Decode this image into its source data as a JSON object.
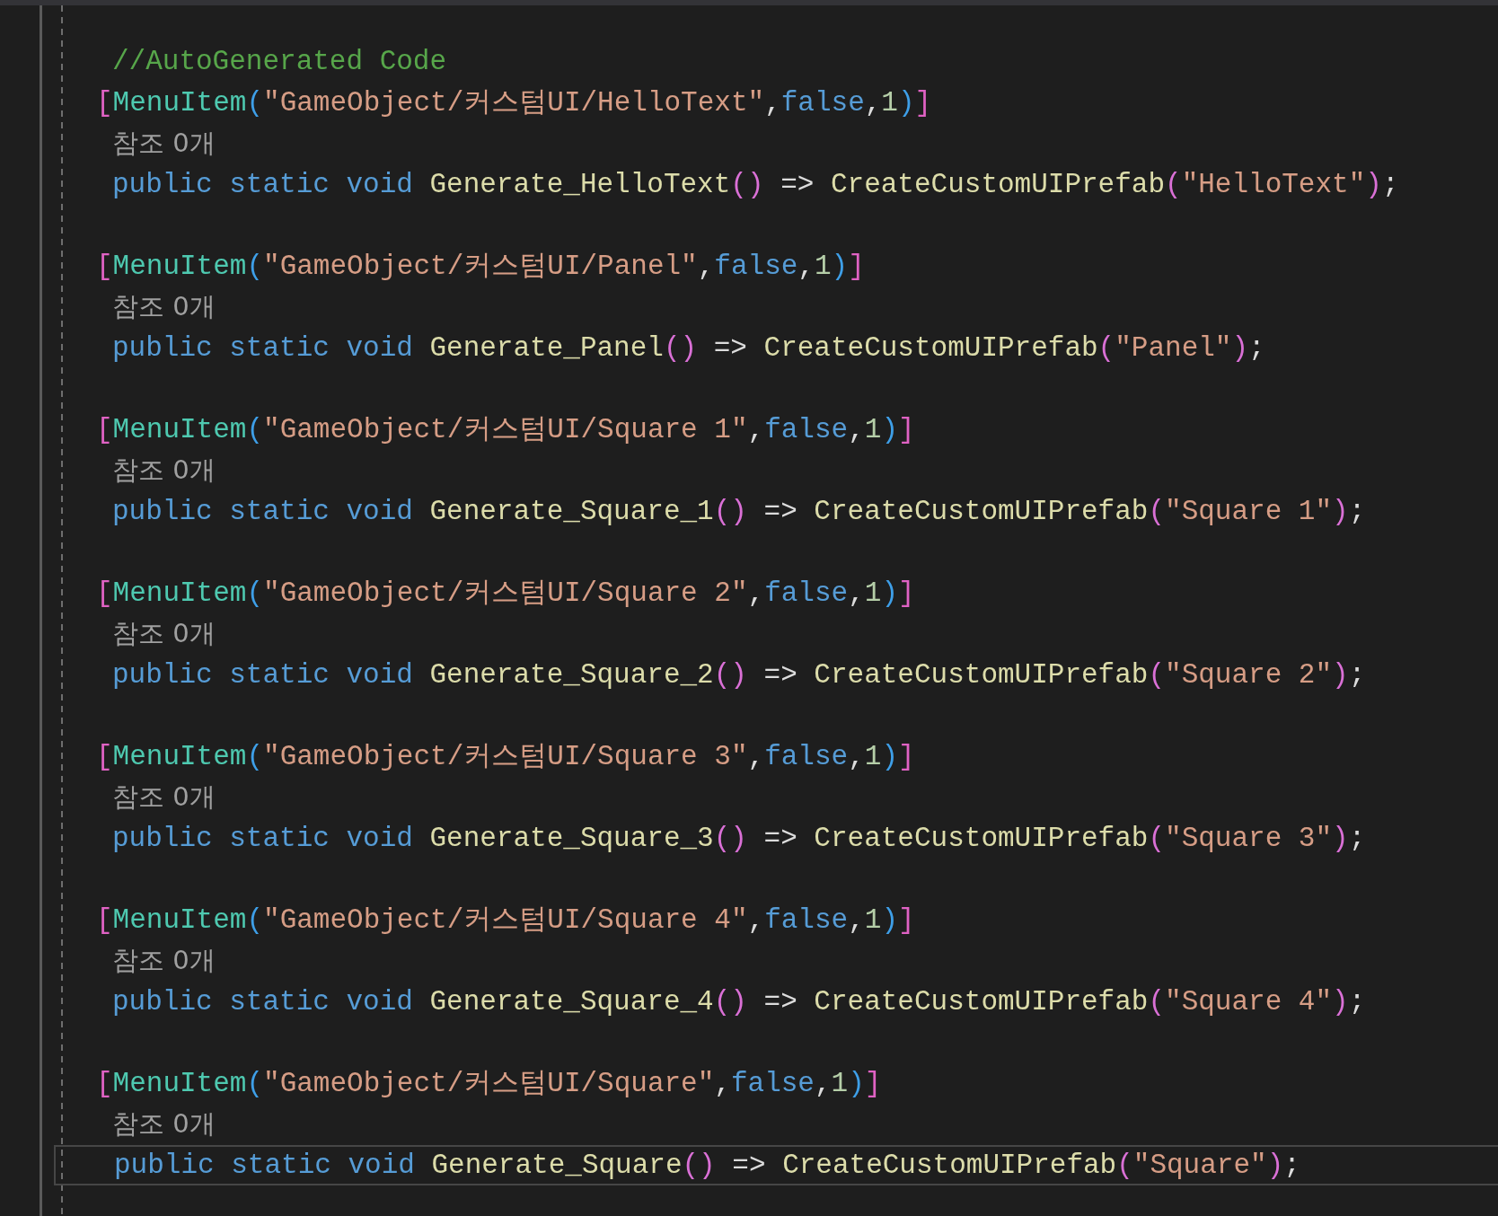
{
  "editor": {
    "lines": [
      {
        "kind": "comment",
        "text": "//AutoGenerated Code"
      },
      {
        "kind": "attribute",
        "tokens": [
          {
            "kind": "bracket",
            "text": "["
          },
          {
            "kind": "type",
            "text": "MenuItem"
          },
          {
            "kind": "paren1",
            "text": "("
          },
          {
            "kind": "string",
            "text": "\"GameObject/커스텀UI/HelloText\""
          },
          {
            "kind": "punct",
            "text": ","
          },
          {
            "kind": "keyword",
            "text": "false"
          },
          {
            "kind": "punct",
            "text": ","
          },
          {
            "kind": "number",
            "text": "1"
          },
          {
            "kind": "paren1",
            "text": ")"
          },
          {
            "kind": "bracket",
            "text": "]"
          }
        ]
      },
      {
        "kind": "codelens",
        "text": "참조 0개"
      },
      {
        "kind": "code",
        "current": false,
        "tokens": [
          {
            "kind": "decl",
            "text": "public static void"
          },
          {
            "kind": "method",
            "text": "Generate_HelloText"
          },
          {
            "kind": "paren2",
            "text": "()"
          },
          {
            "kind": "punct",
            "text": " => "
          },
          {
            "kind": "method",
            "text": "CreateCustomUIPrefab"
          },
          {
            "kind": "paren2",
            "text": "("
          },
          {
            "kind": "string",
            "text": "\"HelloText\""
          },
          {
            "kind": "paren2",
            "text": ")"
          },
          {
            "kind": "punct",
            "text": ";"
          }
        ]
      },
      {
        "kind": "blank"
      },
      {
        "kind": "attribute",
        "tokens": [
          {
            "kind": "bracket",
            "text": "["
          },
          {
            "kind": "type",
            "text": "MenuItem"
          },
          {
            "kind": "paren1",
            "text": "("
          },
          {
            "kind": "string",
            "text": "\"GameObject/커스텀UI/Panel\""
          },
          {
            "kind": "punct",
            "text": ","
          },
          {
            "kind": "keyword",
            "text": "false"
          },
          {
            "kind": "punct",
            "text": ","
          },
          {
            "kind": "number",
            "text": "1"
          },
          {
            "kind": "paren1",
            "text": ")"
          },
          {
            "kind": "bracket",
            "text": "]"
          }
        ]
      },
      {
        "kind": "codelens",
        "text": "참조 0개"
      },
      {
        "kind": "code",
        "current": false,
        "tokens": [
          {
            "kind": "decl",
            "text": "public static void"
          },
          {
            "kind": "method",
            "text": "Generate_Panel"
          },
          {
            "kind": "paren2",
            "text": "()"
          },
          {
            "kind": "punct",
            "text": " => "
          },
          {
            "kind": "method",
            "text": "CreateCustomUIPrefab"
          },
          {
            "kind": "paren2",
            "text": "("
          },
          {
            "kind": "string",
            "text": "\"Panel\""
          },
          {
            "kind": "paren2",
            "text": ")"
          },
          {
            "kind": "punct",
            "text": ";"
          }
        ]
      },
      {
        "kind": "blank"
      },
      {
        "kind": "attribute",
        "tokens": [
          {
            "kind": "bracket",
            "text": "["
          },
          {
            "kind": "type",
            "text": "MenuItem"
          },
          {
            "kind": "paren1",
            "text": "("
          },
          {
            "kind": "string",
            "text": "\"GameObject/커스텀UI/Square 1\""
          },
          {
            "kind": "punct",
            "text": ","
          },
          {
            "kind": "keyword",
            "text": "false"
          },
          {
            "kind": "punct",
            "text": ","
          },
          {
            "kind": "number",
            "text": "1"
          },
          {
            "kind": "paren1",
            "text": ")"
          },
          {
            "kind": "bracket",
            "text": "]"
          }
        ]
      },
      {
        "kind": "codelens",
        "text": "참조 0개"
      },
      {
        "kind": "code",
        "current": false,
        "tokens": [
          {
            "kind": "decl",
            "text": "public static void"
          },
          {
            "kind": "method",
            "text": "Generate_Square_1"
          },
          {
            "kind": "paren2",
            "text": "()"
          },
          {
            "kind": "punct",
            "text": " => "
          },
          {
            "kind": "method",
            "text": "CreateCustomUIPrefab"
          },
          {
            "kind": "paren2",
            "text": "("
          },
          {
            "kind": "string",
            "text": "\"Square 1\""
          },
          {
            "kind": "paren2",
            "text": ")"
          },
          {
            "kind": "punct",
            "text": ";"
          }
        ]
      },
      {
        "kind": "blank"
      },
      {
        "kind": "attribute",
        "tokens": [
          {
            "kind": "bracket",
            "text": "["
          },
          {
            "kind": "type",
            "text": "MenuItem"
          },
          {
            "kind": "paren1",
            "text": "("
          },
          {
            "kind": "string",
            "text": "\"GameObject/커스텀UI/Square 2\""
          },
          {
            "kind": "punct",
            "text": ","
          },
          {
            "kind": "keyword",
            "text": "false"
          },
          {
            "kind": "punct",
            "text": ","
          },
          {
            "kind": "number",
            "text": "1"
          },
          {
            "kind": "paren1",
            "text": ")"
          },
          {
            "kind": "bracket",
            "text": "]"
          }
        ]
      },
      {
        "kind": "codelens",
        "text": "참조 0개"
      },
      {
        "kind": "code",
        "current": false,
        "tokens": [
          {
            "kind": "decl",
            "text": "public static void"
          },
          {
            "kind": "method",
            "text": "Generate_Square_2"
          },
          {
            "kind": "paren2",
            "text": "()"
          },
          {
            "kind": "punct",
            "text": " => "
          },
          {
            "kind": "method",
            "text": "CreateCustomUIPrefab"
          },
          {
            "kind": "paren2",
            "text": "("
          },
          {
            "kind": "string",
            "text": "\"Square 2\""
          },
          {
            "kind": "paren2",
            "text": ")"
          },
          {
            "kind": "punct",
            "text": ";"
          }
        ]
      },
      {
        "kind": "blank"
      },
      {
        "kind": "attribute",
        "tokens": [
          {
            "kind": "bracket",
            "text": "["
          },
          {
            "kind": "type",
            "text": "MenuItem"
          },
          {
            "kind": "paren1",
            "text": "("
          },
          {
            "kind": "string",
            "text": "\"GameObject/커스텀UI/Square 3\""
          },
          {
            "kind": "punct",
            "text": ","
          },
          {
            "kind": "keyword",
            "text": "false"
          },
          {
            "kind": "punct",
            "text": ","
          },
          {
            "kind": "number",
            "text": "1"
          },
          {
            "kind": "paren1",
            "text": ")"
          },
          {
            "kind": "bracket",
            "text": "]"
          }
        ]
      },
      {
        "kind": "codelens",
        "text": "참조 0개"
      },
      {
        "kind": "code",
        "current": false,
        "tokens": [
          {
            "kind": "decl",
            "text": "public static void"
          },
          {
            "kind": "method",
            "text": "Generate_Square_3"
          },
          {
            "kind": "paren2",
            "text": "()"
          },
          {
            "kind": "punct",
            "text": " => "
          },
          {
            "kind": "method",
            "text": "CreateCustomUIPrefab"
          },
          {
            "kind": "paren2",
            "text": "("
          },
          {
            "kind": "string",
            "text": "\"Square 3\""
          },
          {
            "kind": "paren2",
            "text": ")"
          },
          {
            "kind": "punct",
            "text": ";"
          }
        ]
      },
      {
        "kind": "blank"
      },
      {
        "kind": "attribute",
        "tokens": [
          {
            "kind": "bracket",
            "text": "["
          },
          {
            "kind": "type",
            "text": "MenuItem"
          },
          {
            "kind": "paren1",
            "text": "("
          },
          {
            "kind": "string",
            "text": "\"GameObject/커스텀UI/Square 4\""
          },
          {
            "kind": "punct",
            "text": ","
          },
          {
            "kind": "keyword",
            "text": "false"
          },
          {
            "kind": "punct",
            "text": ","
          },
          {
            "kind": "number",
            "text": "1"
          },
          {
            "kind": "paren1",
            "text": ")"
          },
          {
            "kind": "bracket",
            "text": "]"
          }
        ]
      },
      {
        "kind": "codelens",
        "text": "참조 0개"
      },
      {
        "kind": "code",
        "current": false,
        "tokens": [
          {
            "kind": "decl",
            "text": "public static void"
          },
          {
            "kind": "method",
            "text": "Generate_Square_4"
          },
          {
            "kind": "paren2",
            "text": "()"
          },
          {
            "kind": "punct",
            "text": " => "
          },
          {
            "kind": "method",
            "text": "CreateCustomUIPrefab"
          },
          {
            "kind": "paren2",
            "text": "("
          },
          {
            "kind": "string",
            "text": "\"Square 4\""
          },
          {
            "kind": "paren2",
            "text": ")"
          },
          {
            "kind": "punct",
            "text": ";"
          }
        ]
      },
      {
        "kind": "blank"
      },
      {
        "kind": "attribute",
        "tokens": [
          {
            "kind": "bracket",
            "text": "["
          },
          {
            "kind": "type",
            "text": "MenuItem"
          },
          {
            "kind": "paren1",
            "text": "("
          },
          {
            "kind": "string",
            "text": "\"GameObject/커스텀UI/Square\""
          },
          {
            "kind": "punct",
            "text": ","
          },
          {
            "kind": "keyword",
            "text": "false"
          },
          {
            "kind": "punct",
            "text": ","
          },
          {
            "kind": "number",
            "text": "1"
          },
          {
            "kind": "paren1",
            "text": ")"
          },
          {
            "kind": "bracket",
            "text": "]"
          }
        ]
      },
      {
        "kind": "codelens",
        "text": "참조 0개"
      },
      {
        "kind": "code",
        "current": true,
        "tokens": [
          {
            "kind": "decl",
            "text": "public static void"
          },
          {
            "kind": "method",
            "text": "Generate_Square"
          },
          {
            "kind": "paren2",
            "text": "()"
          },
          {
            "kind": "punct",
            "text": " => "
          },
          {
            "kind": "method",
            "text": "CreateCustomUIPrefab"
          },
          {
            "kind": "paren2",
            "text": "("
          },
          {
            "kind": "string",
            "text": "\"Square\""
          },
          {
            "kind": "paren2",
            "text": ")"
          },
          {
            "kind": "punct",
            "text": ";"
          }
        ]
      }
    ]
  }
}
